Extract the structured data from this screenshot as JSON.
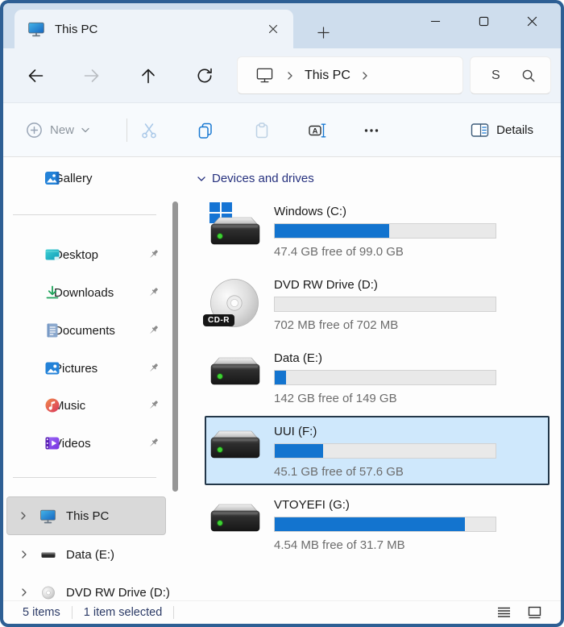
{
  "colors": {
    "accent": "#1374cf",
    "window_border": "#2e5f94",
    "titlebar_bg": "#cedded",
    "selection_fill": "#cfe8fc",
    "selection_border": "#233749",
    "group_header_text": "#26317e",
    "bar_track": "#e9e9e9",
    "muted_text": "#6c6c6c"
  },
  "titlebar": {
    "tab_title": "This PC"
  },
  "navbar": {
    "breadcrumb": "This PC",
    "search_text": "S"
  },
  "toolbar": {
    "new_label": "New",
    "details_label": "Details"
  },
  "sidebar": {
    "pinned": [
      {
        "label": "Gallery",
        "icon": "gallery-icon",
        "pinned": false
      },
      {
        "label": "Desktop",
        "icon": "desktop-icon",
        "pinned": true
      },
      {
        "label": "Downloads",
        "icon": "downloads-icon",
        "pinned": true
      },
      {
        "label": "Documents",
        "icon": "documents-icon",
        "pinned": true
      },
      {
        "label": "Pictures",
        "icon": "pictures-icon",
        "pinned": true
      },
      {
        "label": "Music",
        "icon": "music-icon",
        "pinned": true
      },
      {
        "label": "Videos",
        "icon": "videos-icon",
        "pinned": true
      }
    ],
    "tree": [
      {
        "label": "This PC",
        "icon": "monitor-icon",
        "selected": true
      },
      {
        "label": "Data (E:)",
        "icon": "hdd-small-icon",
        "selected": false
      },
      {
        "label": "DVD RW Drive (D:)",
        "icon": "disc-small-icon",
        "selected": false
      }
    ]
  },
  "main": {
    "group_header": "Devices and drives",
    "drives": [
      {
        "name": "Windows (C:)",
        "free_text": "47.4 GB free of 99.0 GB",
        "fill_percent": 52,
        "icon": "hdd-windows-icon",
        "selected": false
      },
      {
        "name": "DVD RW Drive (D:)",
        "free_text": "702 MB free of 702 MB",
        "fill_percent": 0,
        "icon": "optical-disc-icon",
        "badge": "CD-R",
        "selected": false
      },
      {
        "name": "Data (E:)",
        "free_text": "142 GB free of 149 GB",
        "fill_percent": 5,
        "icon": "hdd-icon",
        "selected": false
      },
      {
        "name": "UUI (F:)",
        "free_text": "45.1 GB free of 57.6 GB",
        "fill_percent": 22,
        "icon": "hdd-icon",
        "selected": true
      },
      {
        "name": "VTOYEFI (G:)",
        "free_text": "4.54 MB free of 31.7 MB",
        "fill_percent": 86,
        "icon": "hdd-icon",
        "selected": false
      }
    ]
  },
  "statusbar": {
    "count": "5 items",
    "selected": "1 item selected"
  }
}
